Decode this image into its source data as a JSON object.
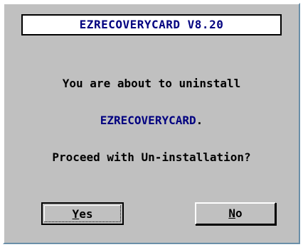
{
  "dialog": {
    "title": "EZRECOVERYCARD V8.20",
    "message_line1": "You are about to uninstall",
    "product_name": "EZRECOVERYCARD",
    "product_suffix": ".",
    "question": "Proceed with Un-installation?"
  },
  "buttons": {
    "yes": {
      "mnemonic": "Y",
      "rest": "es"
    },
    "no": {
      "mnemonic": "N",
      "rest": "o"
    }
  },
  "colors": {
    "dialog_background": "#c0c0c0",
    "title_text": "#000080",
    "product_name_text": "#000080",
    "body_text": "#000000"
  }
}
